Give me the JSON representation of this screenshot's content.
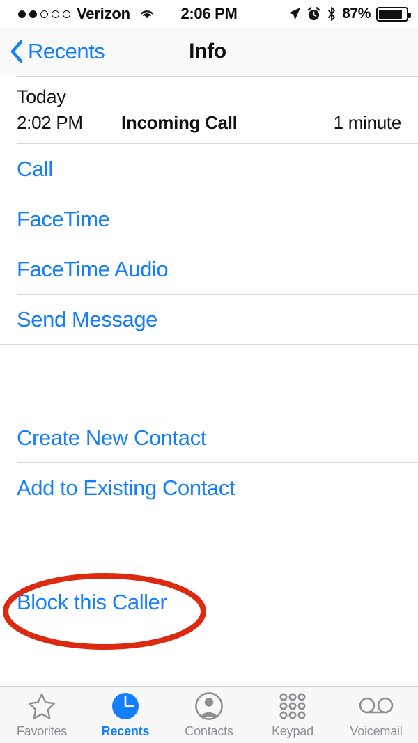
{
  "status_bar": {
    "signal_dots_filled": 2,
    "signal_dots_total": 5,
    "carrier": "Verizon",
    "wifi_icon": "wifi-icon",
    "time": "2:06 PM",
    "location_icon": "location-arrow-icon",
    "alarm_icon": "alarm-clock-icon",
    "bluetooth_icon": "bluetooth-icon",
    "battery_percent": "87%",
    "battery_level": 87
  },
  "nav_bar": {
    "back_icon": "chevron-left-icon",
    "back_label": "Recents",
    "title": "Info"
  },
  "call_detail": {
    "date_header": "Today",
    "time": "2:02 PM",
    "type": "Incoming Call",
    "duration": "1 minute"
  },
  "actions_primary": [
    {
      "label": "Call",
      "name": "call-row"
    },
    {
      "label": "FaceTime",
      "name": "facetime-row"
    },
    {
      "label": "FaceTime Audio",
      "name": "facetime-audio-row"
    },
    {
      "label": "Send Message",
      "name": "send-message-row"
    }
  ],
  "actions_contact": [
    {
      "label": "Create New Contact",
      "name": "create-new-contact-row"
    },
    {
      "label": "Add to Existing Contact",
      "name": "add-to-existing-contact-row"
    }
  ],
  "actions_block": [
    {
      "label": "Block this Caller",
      "name": "block-this-caller-row"
    }
  ],
  "annotation": {
    "shape": "ellipse",
    "color": "#dc2a11",
    "target": "Block this Caller"
  },
  "tab_bar": {
    "active_index": 1,
    "tabs": [
      {
        "label": "Favorites",
        "icon": "star-icon"
      },
      {
        "label": "Recents",
        "icon": "clock-icon"
      },
      {
        "label": "Contacts",
        "icon": "person-circle-icon"
      },
      {
        "label": "Keypad",
        "icon": "keypad-grid-icon"
      },
      {
        "label": "Voicemail",
        "icon": "voicemail-icon"
      }
    ]
  },
  "colors": {
    "accent_blue": "#147efb",
    "annotation_red": "#dc2a11",
    "inactive_gray": "#8e8e93",
    "separator": "#d6d6d6"
  }
}
